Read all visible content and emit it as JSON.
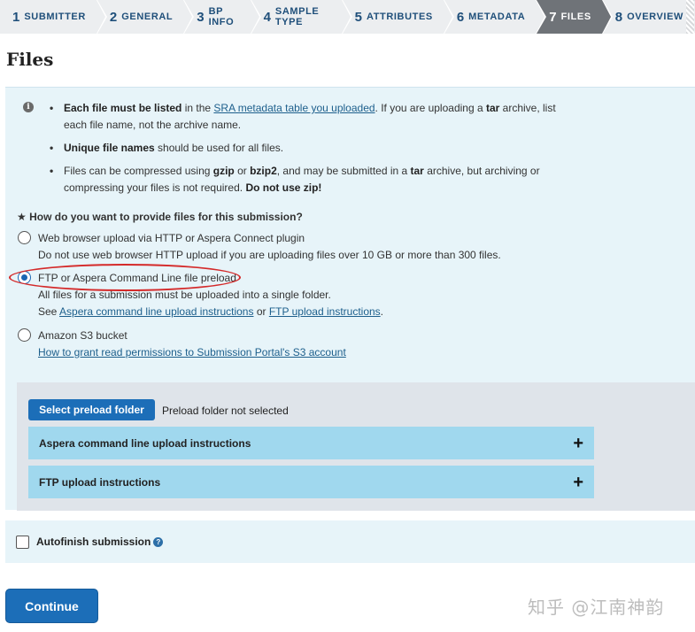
{
  "steps": [
    {
      "num": "1",
      "label": "SUBMITTER"
    },
    {
      "num": "2",
      "label": "GENERAL"
    },
    {
      "num": "3",
      "label": "BP INFO"
    },
    {
      "num": "4",
      "label": "SAMPLE TYPE"
    },
    {
      "num": "5",
      "label": "ATTRIBUTES"
    },
    {
      "num": "6",
      "label": "METADATA"
    },
    {
      "num": "7",
      "label": "FILES"
    },
    {
      "num": "8",
      "label": "OVERVIEW"
    }
  ],
  "page_title": "Files",
  "info": {
    "b1_bold": "Each file must be listed",
    "b1_a": " in the ",
    "b1_link": "SRA metadata table you uploaded",
    "b1_b": ". If you are uploading a ",
    "b1_tar": "tar",
    "b1_c": " archive, list each file name, not the archive name.",
    "b2_bold": "Unique file names",
    "b2_a": " should be used for all files.",
    "b3_a": "Files can be compressed using ",
    "b3_gzip": "gzip",
    "b3_or": " or ",
    "b3_bzip2": "bzip2",
    "b3_b": ", and may be submitted in a ",
    "b3_tar": "tar",
    "b3_c": " archive, but archiving or compressing your files is not required. ",
    "b3_zip": "Do not use zip!"
  },
  "question": "★ How do you want to provide files for this submission?",
  "options": {
    "web": {
      "label": "Web browser upload via HTTP or Aspera Connect plugin",
      "sub": "Do not use web browser HTTP upload if you are uploading files over 10 GB or more than 300 files."
    },
    "ftp": {
      "label": "FTP or Aspera Command Line file preload",
      "sub1": "All files for a submission must be uploaded into a single folder.",
      "see": "See ",
      "link1": "Aspera command line upload instructions",
      "or": " or ",
      "link2": "FTP upload instructions",
      "dot": "."
    },
    "s3": {
      "label": "Amazon S3 bucket",
      "link": "How to grant read permissions to Submission Portal's S3 account"
    }
  },
  "preload": {
    "button": "Select preload folder",
    "status": "Preload folder not selected",
    "acc1": "Aspera command line upload instructions",
    "acc2": "FTP upload instructions",
    "plus": "+"
  },
  "autofinish": "Autofinish submission",
  "help": "?",
  "continue": "Continue",
  "watermark": "知乎 @江南神韵",
  "info_glyph": "i"
}
